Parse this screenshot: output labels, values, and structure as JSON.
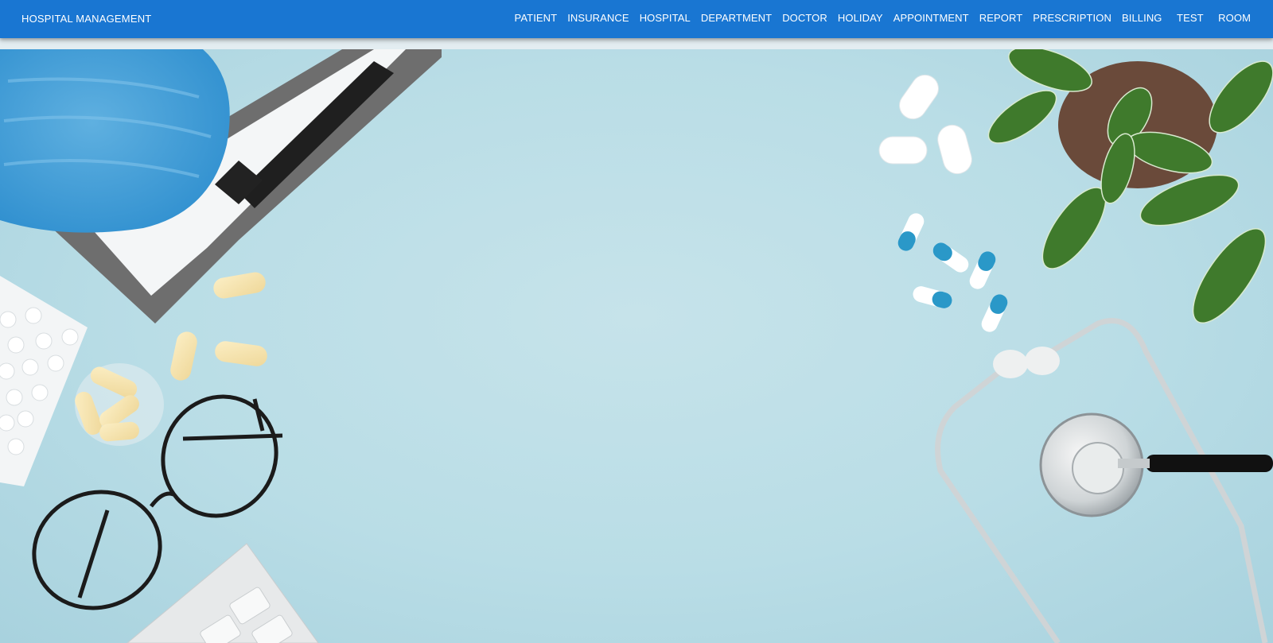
{
  "app": {
    "title": "HOSPITAL MANAGEMENT"
  },
  "nav": {
    "items": [
      {
        "label": "PATIENT"
      },
      {
        "label": "INSURANCE"
      },
      {
        "label": "HOSPITAL"
      },
      {
        "label": "DEPARTMENT"
      },
      {
        "label": "DOCTOR"
      },
      {
        "label": "HOLIDAY"
      },
      {
        "label": "APPOINTMENT"
      },
      {
        "label": "REPORT"
      },
      {
        "label": "PRESCRIPTION"
      },
      {
        "label": "BILLING"
      },
      {
        "label": "TEST"
      },
      {
        "label": "ROOM"
      }
    ]
  },
  "theme": {
    "appbar_color": "#1976d2",
    "hero_background": "#bfe0e8"
  },
  "hero": {
    "objects": [
      "face-mask",
      "clipboard",
      "capsules",
      "pill-blister",
      "eyeglasses",
      "keyboard",
      "pills",
      "plant",
      "stethoscope"
    ]
  }
}
